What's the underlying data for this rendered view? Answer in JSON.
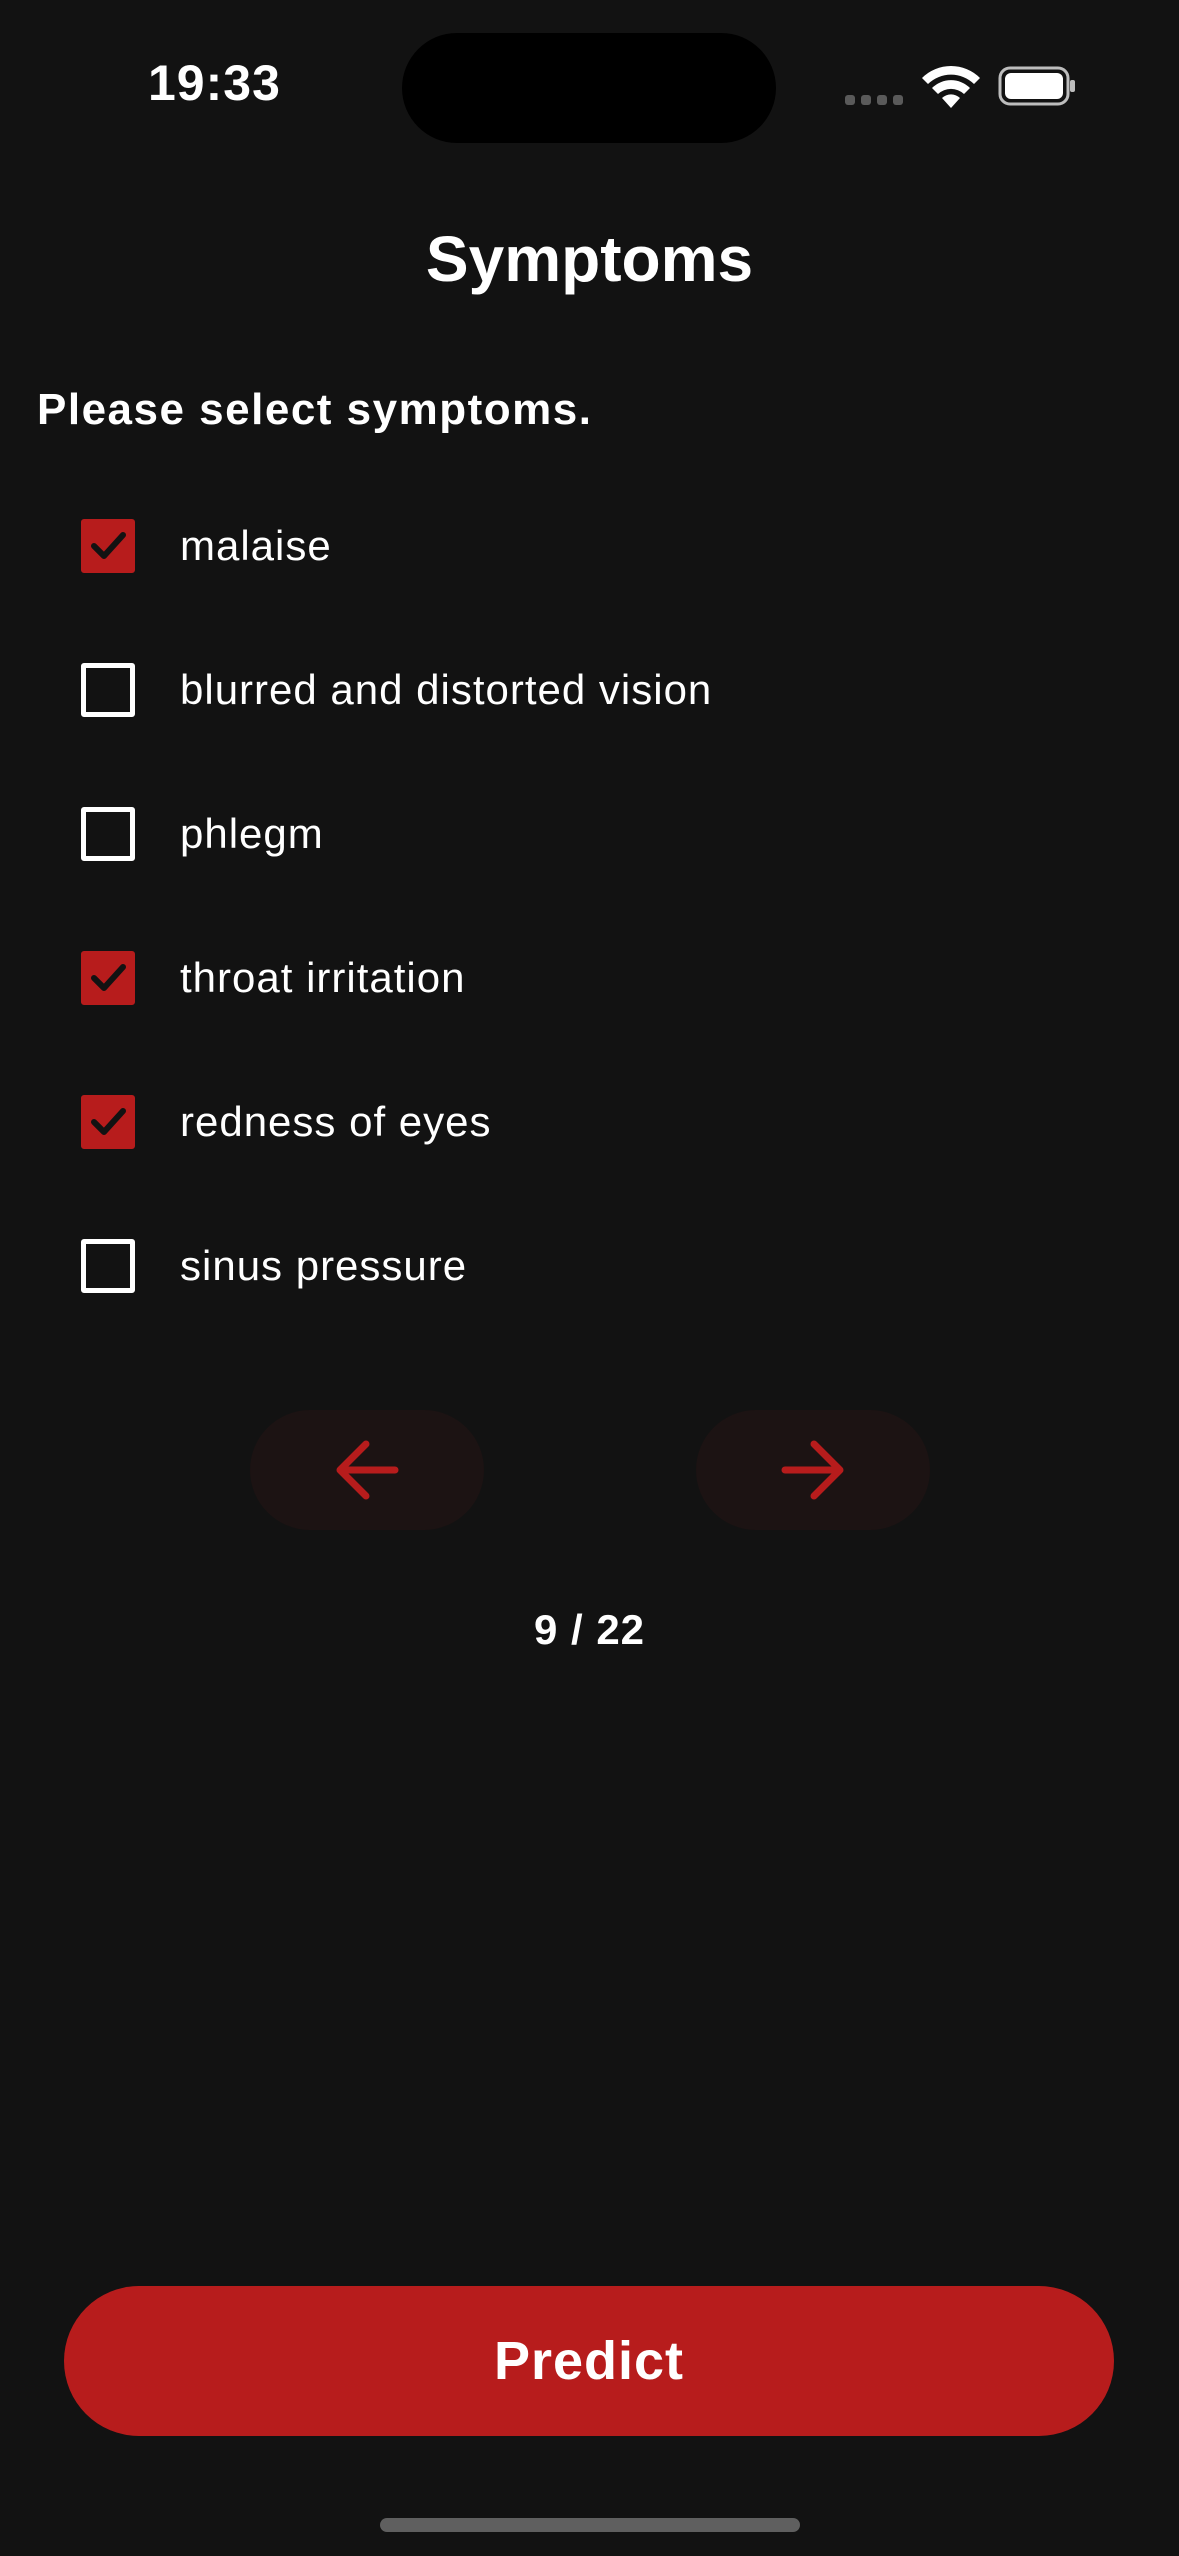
{
  "status_bar": {
    "time": "19:33"
  },
  "header": {
    "title": "Symptoms"
  },
  "prompt": "Please select symptoms.",
  "symptoms": [
    {
      "label": "malaise",
      "checked": true
    },
    {
      "label": "blurred and distorted vision",
      "checked": false
    },
    {
      "label": "phlegm",
      "checked": false
    },
    {
      "label": "throat irritation",
      "checked": true
    },
    {
      "label": "redness of eyes",
      "checked": true
    },
    {
      "label": "sinus pressure",
      "checked": false
    }
  ],
  "pagination": {
    "indicator": "9 / 22",
    "prev_icon": "arrow-left-icon",
    "next_icon": "arrow-right-icon"
  },
  "predict_button": {
    "label": "Predict"
  },
  "colors": {
    "background": "#121212",
    "accent": "#b71c1c",
    "nav_button_bg": "#1c1313",
    "text": "#ffffff"
  }
}
